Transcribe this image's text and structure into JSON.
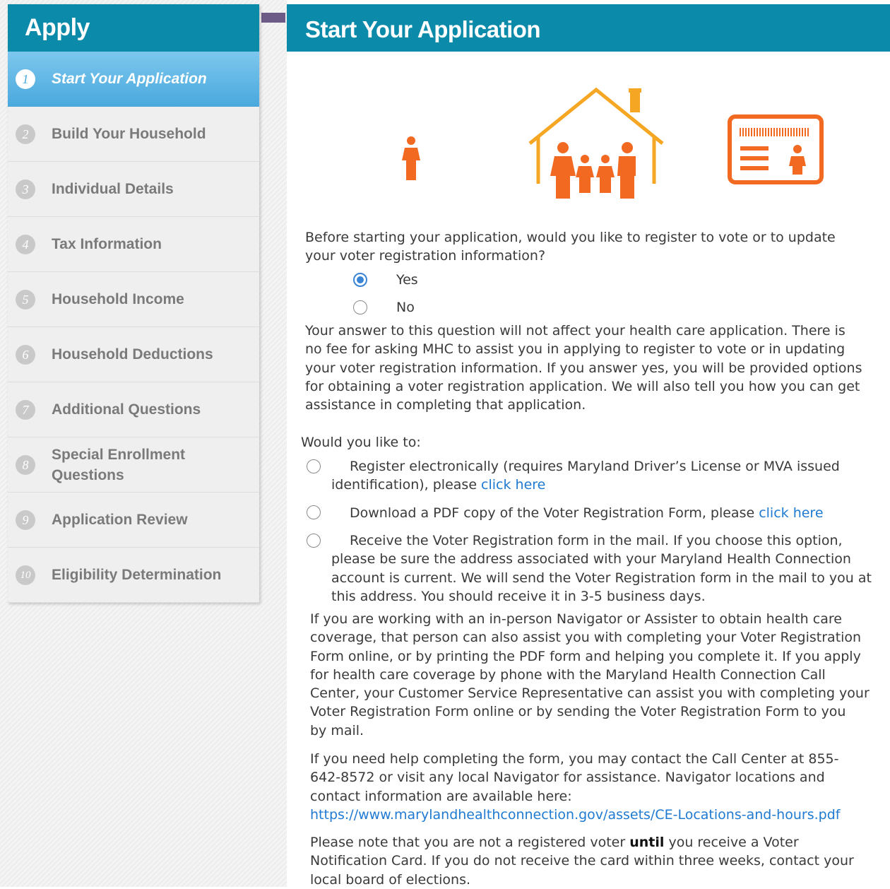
{
  "sidebar": {
    "title": "Apply",
    "steps": [
      {
        "num": "1",
        "label": "Start Your Application"
      },
      {
        "num": "2",
        "label": "Build Your Household"
      },
      {
        "num": "3",
        "label": "Individual Details"
      },
      {
        "num": "4",
        "label": "Tax Information"
      },
      {
        "num": "5",
        "label": "Household Income"
      },
      {
        "num": "6",
        "label": "Household Deductions"
      },
      {
        "num": "7",
        "label": "Additional Questions"
      },
      {
        "num": "8",
        "label": "Special Enrollment Questions"
      },
      {
        "num": "9",
        "label": "Application Review"
      },
      {
        "num": "10",
        "label": "Eligibility Determination"
      }
    ]
  },
  "main": {
    "title": "Start Your Application",
    "question_line1": "Before starting your application, would you like to register to vote or to update",
    "question_line2": "your voter registration information?",
    "yes_label": "Yes",
    "no_label": "No",
    "selected": "Yes",
    "disclaimer_lines": [
      "Your answer to this question will not affect your health care application. There is",
      "no fee for asking MHC to assist you in applying to register to vote or in updating",
      "your voter registration information. If you answer yes, you will be provided options",
      "for obtaining a voter registration application. We will also tell you how you can get",
      "assistance in completing that application."
    ],
    "would_you_like": "Would you like to:",
    "option1_line1": "Register electronically (requires Maryland Driver’s License or MVA issued",
    "option1_line2_text": "identification), please ",
    "option1_link": "click here",
    "option2_text": "Download a PDF copy of the Voter Registration Form, please ",
    "option2_link": "click here",
    "option3_lines": [
      "Receive the Voter Registration form in the mail. If you choose this option,",
      "please be sure the address associated with your Maryland Health Connection",
      "account is current. We will send the Voter Registration form in the mail to you at",
      "this address. You should receive it in 3-5 business days."
    ],
    "navigator_lines": [
      "If you are working with an in-person Navigator or Assister to obtain health care",
      "coverage, that person can also assist you with completing your Voter Registration",
      "Form online, or by printing the PDF form and helping you complete it. If you apply",
      "for health care coverage by phone with the Maryland Health Connection Call",
      "Center, your Customer Service Representative can assist you with completing your",
      "Voter Registration Form online or by sending the Voter Registration Form to you",
      "by mail."
    ],
    "help_lines": [
      "If you need help completing the form, you may contact the Call Center at 855-",
      "642-8572 or visit any local Navigator for assistance. Navigator locations and",
      "contact information are available here:"
    ],
    "help_link": "https://www.marylandhealthconnection.gov/assets/CE-Locations-and-hours.pdf",
    "note_part1": "Please note that you are not a registered voter ",
    "note_bold": "until",
    "note_part2": " you receive a Voter",
    "note_lines": [
      "Notification Card. If you do not receive the card within three weeks, contact your",
      "local board of elections."
    ]
  },
  "colors": {
    "header": "#0b8ba9",
    "active_step": "#4aa9dd",
    "illustration": "#f26a21",
    "link": "#1f7ad1",
    "radio_selected": "#3a84d6"
  },
  "icons": [
    "person-icon",
    "family-house-icon",
    "voter-card-icon"
  ]
}
